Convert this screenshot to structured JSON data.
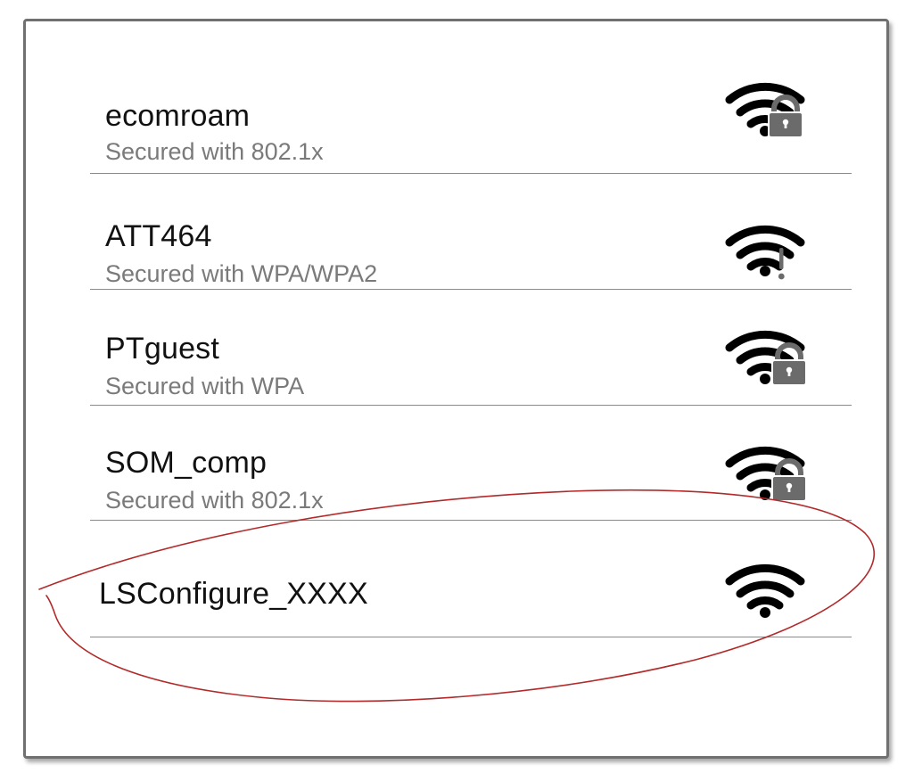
{
  "networks": [
    {
      "name": "ecomroam",
      "security": "Secured with 802.1x",
      "icon": "wifi-locked-icon"
    },
    {
      "name": "ATT464",
      "security": "Secured with WPA/WPA2",
      "icon": "wifi-alert-icon"
    },
    {
      "name": "PTguest",
      "security": "Secured with WPA",
      "icon": "wifi-locked-icon"
    },
    {
      "name": "SOM_comp",
      "security": "Secured with 802.1x",
      "icon": "wifi-locked-icon"
    },
    {
      "name": "LSConfigure_XXXX",
      "security": "",
      "icon": "wifi-open-icon"
    }
  ],
  "colors": {
    "text_primary": "#111111",
    "text_secondary": "#7a7a7a",
    "divider": "#8a8a8a",
    "icon": "#000000",
    "lock": "#6b6b6b",
    "annotation": "#b22a2a"
  }
}
